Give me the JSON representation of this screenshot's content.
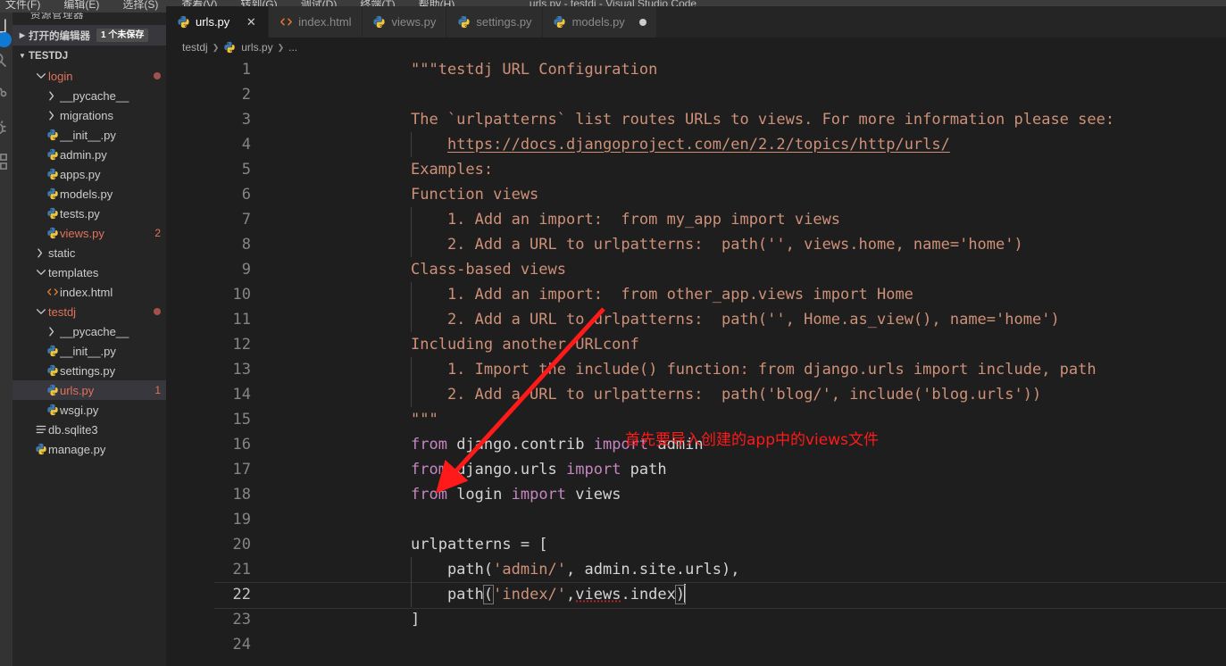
{
  "window": {
    "title": "urls.py - testdj - Visual Studio Code",
    "menu": [
      "文件(F)",
      "编辑(E)",
      "选择(S)",
      "查看(V)",
      "转到(G)",
      "调试(D)",
      "终端(T)",
      "帮助(H)"
    ]
  },
  "activitybar": {
    "items": [
      {
        "name": "explorer-icon",
        "label": "资源管理器"
      },
      {
        "name": "search-icon",
        "label": "搜索"
      },
      {
        "name": "source-control-icon",
        "label": "源代码管理"
      },
      {
        "name": "debug-icon",
        "label": "调试"
      },
      {
        "name": "extensions-icon",
        "label": "扩展"
      }
    ]
  },
  "sidebar": {
    "title": "资源管理器",
    "open_editors": {
      "label": "打开的编辑器",
      "badge": "1 个未保存"
    },
    "project": {
      "label": "TESTDJ"
    },
    "tree": [
      {
        "label": "login",
        "icon": "folder-open",
        "indent": 1,
        "color": "mod",
        "marker": "dot",
        "selected": false
      },
      {
        "label": "__pycache__",
        "icon": "folder",
        "indent": 2,
        "color": "norm",
        "marker": "",
        "selected": false
      },
      {
        "label": "migrations",
        "icon": "folder",
        "indent": 2,
        "color": "norm",
        "marker": "",
        "selected": false
      },
      {
        "label": "__init__.py",
        "icon": "python",
        "indent": 2,
        "color": "norm",
        "marker": "",
        "selected": false
      },
      {
        "label": "admin.py",
        "icon": "python",
        "indent": 2,
        "color": "norm",
        "marker": "",
        "selected": false
      },
      {
        "label": "apps.py",
        "icon": "python",
        "indent": 2,
        "color": "norm",
        "marker": "",
        "selected": false
      },
      {
        "label": "models.py",
        "icon": "python",
        "indent": 2,
        "color": "norm",
        "marker": "",
        "selected": false
      },
      {
        "label": "tests.py",
        "icon": "python",
        "indent": 2,
        "color": "norm",
        "marker": "",
        "selected": false
      },
      {
        "label": "views.py",
        "icon": "python",
        "indent": 2,
        "color": "mod",
        "marker": "2",
        "selected": false
      },
      {
        "label": "static",
        "icon": "folder",
        "indent": 1,
        "color": "norm",
        "marker": "",
        "selected": false
      },
      {
        "label": "templates",
        "icon": "folder-open",
        "indent": 1,
        "color": "norm",
        "marker": "",
        "selected": false
      },
      {
        "label": "index.html",
        "icon": "html",
        "indent": 2,
        "color": "norm",
        "marker": "",
        "selected": false
      },
      {
        "label": "testdj",
        "icon": "folder-open",
        "indent": 1,
        "color": "mod",
        "marker": "dot",
        "selected": false
      },
      {
        "label": "__pycache__",
        "icon": "folder",
        "indent": 2,
        "color": "norm",
        "marker": "",
        "selected": false
      },
      {
        "label": "__init__.py",
        "icon": "python",
        "indent": 2,
        "color": "norm",
        "marker": "",
        "selected": false
      },
      {
        "label": "settings.py",
        "icon": "python",
        "indent": 2,
        "color": "norm",
        "marker": "",
        "selected": false
      },
      {
        "label": "urls.py",
        "icon": "python",
        "indent": 2,
        "color": "mod",
        "marker": "1",
        "selected": true
      },
      {
        "label": "wsgi.py",
        "icon": "python",
        "indent": 2,
        "color": "norm",
        "marker": "",
        "selected": false
      },
      {
        "label": "db.sqlite3",
        "icon": "database",
        "indent": 1,
        "color": "norm",
        "marker": "",
        "selected": false
      },
      {
        "label": "manage.py",
        "icon": "python",
        "indent": 1,
        "color": "norm",
        "marker": "",
        "selected": false
      }
    ]
  },
  "tabs": [
    {
      "label": "urls.py",
      "icon": "python",
      "active": true,
      "close": true,
      "dirty": false
    },
    {
      "label": "index.html",
      "icon": "html",
      "active": false,
      "close": false,
      "dirty": false
    },
    {
      "label": "views.py",
      "icon": "python",
      "active": false,
      "close": false,
      "dirty": false
    },
    {
      "label": "settings.py",
      "icon": "python",
      "active": false,
      "close": false,
      "dirty": false
    },
    {
      "label": "models.py",
      "icon": "python",
      "active": false,
      "close": false,
      "dirty": true
    }
  ],
  "breadcrumb": [
    "testdj",
    "urls.py",
    "..."
  ],
  "editor": {
    "current_line": 22,
    "lines": [
      {
        "n": 1,
        "guides": [],
        "tokens": [
          {
            "t": "\"\"\"testdj URL Configuration",
            "c": "s-doc"
          }
        ]
      },
      {
        "n": 2,
        "guides": [],
        "tokens": []
      },
      {
        "n": 3,
        "guides": [],
        "tokens": [
          {
            "t": "The `urlpatterns` list routes URLs to views. For more information please see:",
            "c": "s-doc"
          }
        ]
      },
      {
        "n": 4,
        "guides": [
          0
        ],
        "tokens": [
          {
            "t": "    ",
            "c": "s-doc"
          },
          {
            "t": "https://docs.djangoproject.com/en/2.2/topics/http/urls/",
            "c": "link-u"
          }
        ]
      },
      {
        "n": 5,
        "guides": [],
        "tokens": [
          {
            "t": "Examples:",
            "c": "s-doc"
          }
        ]
      },
      {
        "n": 6,
        "guides": [],
        "tokens": [
          {
            "t": "Function views",
            "c": "s-doc"
          }
        ]
      },
      {
        "n": 7,
        "guides": [
          0
        ],
        "tokens": [
          {
            "t": "    1. Add an import:  from my_app import views",
            "c": "s-doc"
          }
        ]
      },
      {
        "n": 8,
        "guides": [
          0
        ],
        "tokens": [
          {
            "t": "    2. Add a URL to urlpatterns:  path('', views.home, name='home')",
            "c": "s-doc"
          }
        ]
      },
      {
        "n": 9,
        "guides": [],
        "tokens": [
          {
            "t": "Class-based views",
            "c": "s-doc"
          }
        ]
      },
      {
        "n": 10,
        "guides": [
          0
        ],
        "tokens": [
          {
            "t": "    1. Add an import:  from other_app.views import Home",
            "c": "s-doc"
          }
        ]
      },
      {
        "n": 11,
        "guides": [
          0
        ],
        "tokens": [
          {
            "t": "    2. Add a URL to urlpatterns:  path('', Home.as_view(), name='home')",
            "c": "s-doc"
          }
        ]
      },
      {
        "n": 12,
        "guides": [],
        "tokens": [
          {
            "t": "Including another URLconf",
            "c": "s-doc"
          }
        ]
      },
      {
        "n": 13,
        "guides": [
          0
        ],
        "tokens": [
          {
            "t": "    1. Import the include() function: from django.urls import include, path",
            "c": "s-doc"
          }
        ]
      },
      {
        "n": 14,
        "guides": [
          0
        ],
        "tokens": [
          {
            "t": "    2. Add a URL to urlpatterns:  path('blog/', include('blog.urls'))",
            "c": "s-doc"
          }
        ]
      },
      {
        "n": 15,
        "guides": [],
        "tokens": [
          {
            "t": "\"\"\"",
            "c": "s-doc"
          }
        ]
      },
      {
        "n": 16,
        "guides": [],
        "tokens": [
          {
            "t": "from",
            "c": "s-kw"
          },
          {
            "t": " django.contrib ",
            "c": "s-txt"
          },
          {
            "t": "import",
            "c": "s-kw"
          },
          {
            "t": " admin",
            "c": "s-txt"
          }
        ]
      },
      {
        "n": 17,
        "guides": [],
        "tokens": [
          {
            "t": "from",
            "c": "s-kw"
          },
          {
            "t": " django.urls ",
            "c": "s-txt"
          },
          {
            "t": "import",
            "c": "s-kw"
          },
          {
            "t": " path",
            "c": "s-txt"
          }
        ]
      },
      {
        "n": 18,
        "guides": [],
        "tokens": [
          {
            "t": "from",
            "c": "s-kw"
          },
          {
            "t": " login ",
            "c": "s-txt"
          },
          {
            "t": "import",
            "c": "s-kw"
          },
          {
            "t": " views",
            "c": "s-txt"
          }
        ]
      },
      {
        "n": 19,
        "guides": [],
        "tokens": []
      },
      {
        "n": 20,
        "guides": [],
        "tokens": [
          {
            "t": "urlpatterns = [",
            "c": "s-txt"
          }
        ]
      },
      {
        "n": 21,
        "guides": [
          0
        ],
        "tokens": [
          {
            "t": "    path(",
            "c": "s-txt"
          },
          {
            "t": "'admin/'",
            "c": "s-str"
          },
          {
            "t": ", admin.site.urls),",
            "c": "s-txt"
          }
        ]
      },
      {
        "n": 22,
        "guides": [
          0
        ],
        "tokens": [
          {
            "t": "    path",
            "c": "s-txt"
          },
          {
            "t": "(",
            "c": "s-txt brk"
          },
          {
            "t": "'index/'",
            "c": "s-str"
          },
          {
            "t": ",",
            "c": "s-txt"
          },
          {
            "t": "views",
            "c": "s-txt sq"
          },
          {
            "t": ".index",
            "c": "s-txt"
          },
          {
            "t": ")",
            "c": "s-txt brk"
          },
          {
            "t": "",
            "c": "caret-here"
          }
        ]
      },
      {
        "n": 23,
        "guides": [],
        "tokens": [
          {
            "t": "]",
            "c": "s-txt"
          }
        ]
      },
      {
        "n": 24,
        "guides": [],
        "tokens": []
      }
    ]
  },
  "annotations": {
    "text": "首先要导入创建的app中的views文件",
    "arrow_color": "#ff1a1a"
  }
}
